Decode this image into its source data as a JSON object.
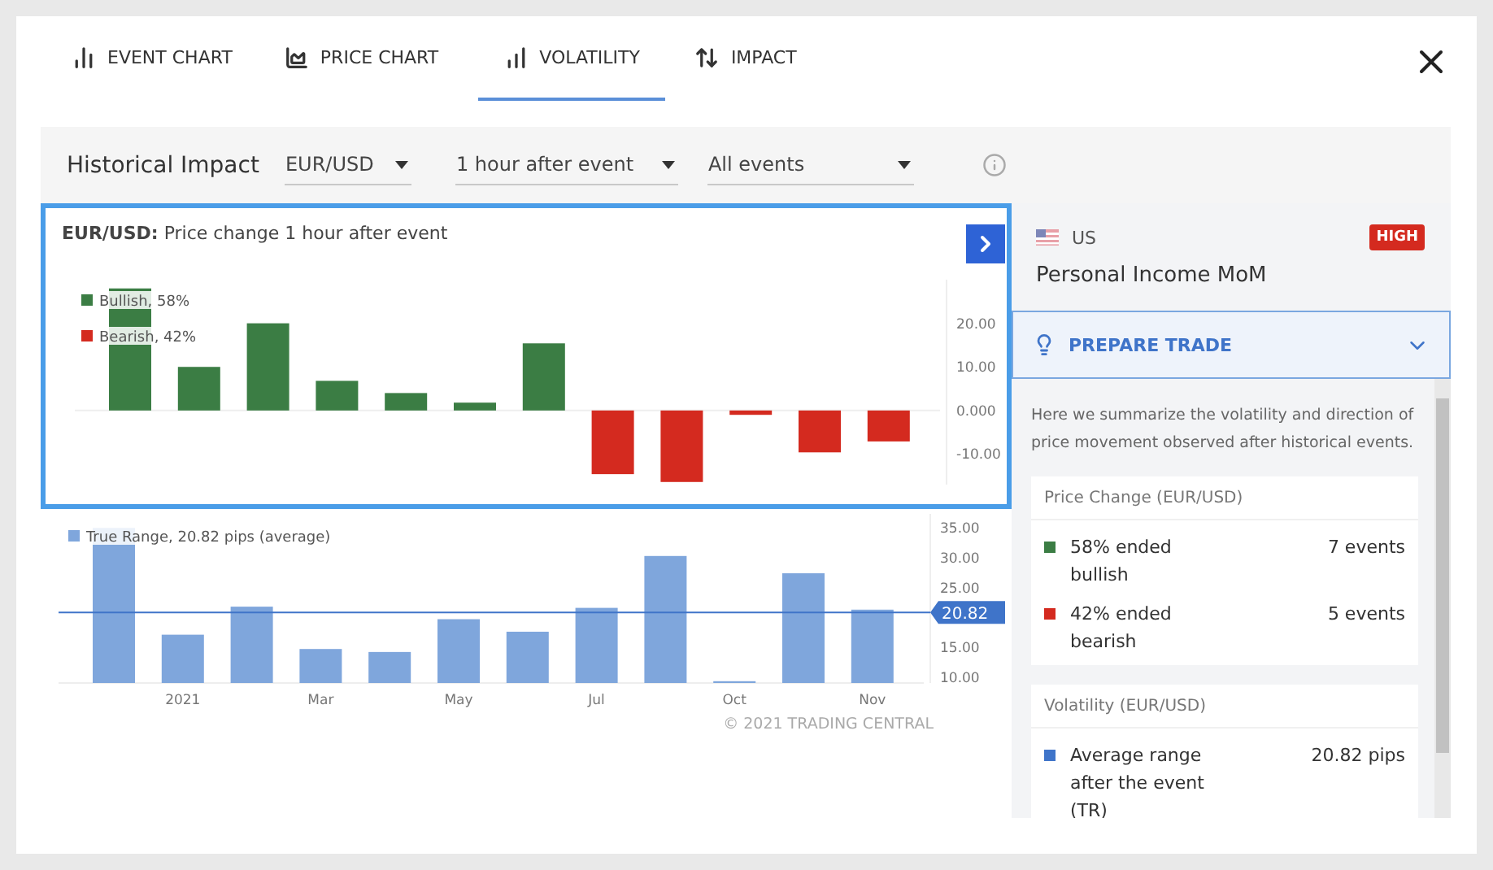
{
  "tabs": [
    {
      "label": "EVENT CHART",
      "selected": false
    },
    {
      "label": "PRICE CHART",
      "selected": false
    },
    {
      "label": "VOLATILITY",
      "selected": true
    },
    {
      "label": "IMPACT",
      "selected": false
    }
  ],
  "filters": {
    "title": "Historical Impact",
    "dropdowns": [
      {
        "value": "EUR/USD"
      },
      {
        "value": "1 hour after event"
      },
      {
        "value": "All events"
      }
    ]
  },
  "price_chart": {
    "title": "**EUR/USD:** Price change 1 hour after event",
    "highlighted": true,
    "chart_data": {
      "type": "bar",
      "legend": "upper left",
      "ylim": [
        -17,
        30
      ],
      "yticks": [
        {
          "value": -10,
          "label": "-10.00"
        },
        {
          "value": 0,
          "label": "0.000"
        },
        {
          "value": 10,
          "label": "10.00"
        },
        {
          "value": 20,
          "label": "20.00"
        }
      ],
      "series": [
        {
          "name": "Bullish, 58%",
          "color": "#3b7d44",
          "values": [
            28,
            10,
            20,
            6.8,
            4,
            1.8,
            15.4,
            null,
            null,
            null,
            null,
            null
          ]
        },
        {
          "name": "Bearish, 42%",
          "color": "#d42a1f",
          "values": [
            null,
            null,
            null,
            null,
            null,
            null,
            null,
            -14.6,
            -16.4,
            -1,
            -9.6,
            -7.1
          ]
        }
      ]
    }
  },
  "volatility_chart": {
    "chart_data": {
      "type": "bar",
      "legend": "upper left",
      "categories": [
        null,
        "2021",
        null,
        "Mar",
        null,
        "May",
        null,
        "Jul",
        null,
        "Oct",
        null,
        "Nov"
      ],
      "ylim": [
        9,
        36
      ],
      "yticks": [
        {
          "value": 10,
          "label": "10.00"
        },
        {
          "value": 15,
          "label": "15.00"
        },
        {
          "value": 25,
          "label": "25.00"
        },
        {
          "value": 30,
          "label": "30.00"
        },
        {
          "value": 35,
          "label": "35.00"
        }
      ],
      "series": [
        {
          "name": "True Range, 20.82 pips (average)",
          "color": "#7fa6dc",
          "values": [
            35,
            17.1,
            21.8,
            14.7,
            14.2,
            19.7,
            17.6,
            21.6,
            30.3,
            9.3,
            27.4,
            21.3
          ]
        }
      ],
      "ref_lines": [
        {
          "axis": "y",
          "value": 20.82,
          "label": "20.82",
          "color": "#3f74c9"
        }
      ]
    },
    "copyright": "© 2021 TRADING CENTRAL"
  },
  "event": {
    "country": "US",
    "impact": "HIGH",
    "name": "Personal Income MoM"
  },
  "prepare_trade": {
    "label": "PREPARE TRADE",
    "expanded": true
  },
  "summary": "Here we summarize the volatility and direction of price movement observed after historical events.",
  "cards": [
    {
      "title": "Price Change (EUR/USD)",
      "rows": [
        {
          "label": "58% ended bullish",
          "value": "7 events",
          "color": "#3b7d44"
        },
        {
          "label": "42% ended bearish",
          "value": "5 events",
          "color": "#d42a1f"
        }
      ]
    },
    {
      "title": "Volatility (EUR/USD)",
      "rows": [
        {
          "label": "Average range after the event (TR)",
          "value": "20.82 pips",
          "color": "#3f74c9"
        }
      ]
    }
  ]
}
